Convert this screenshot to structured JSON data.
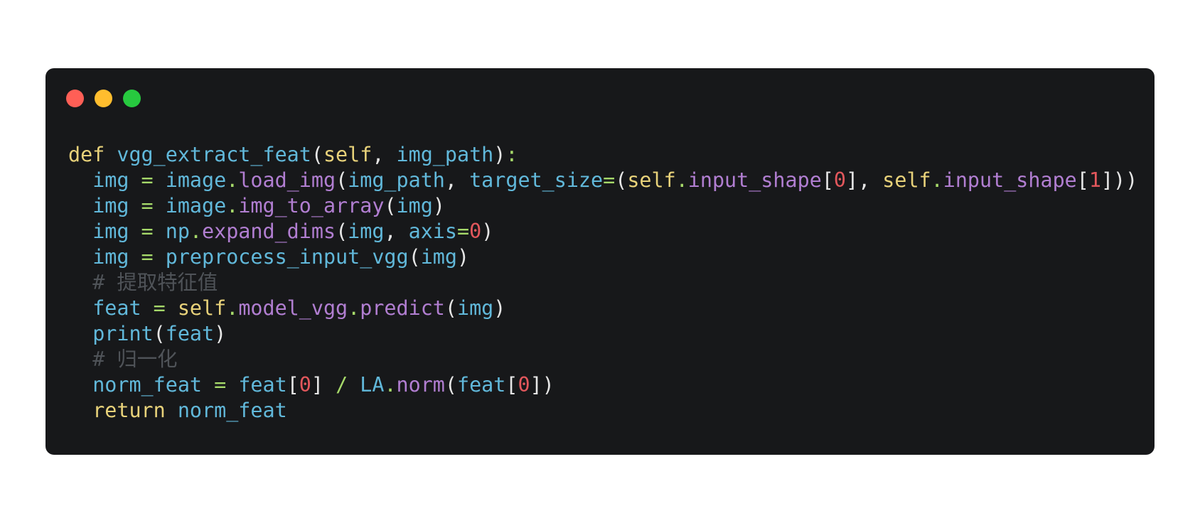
{
  "window": {
    "traffic_lights": [
      {
        "name": "close",
        "color": "#ff5f56"
      },
      {
        "name": "minimize",
        "color": "#ffbd2e"
      },
      {
        "name": "zoom",
        "color": "#27c93f"
      }
    ],
    "background_color": "#17181a"
  },
  "code": {
    "lines": [
      [
        {
          "t": "def",
          "k": "keyword"
        },
        {
          "t": " ",
          "k": "punct"
        },
        {
          "t": "vgg_extract_feat",
          "k": "fn"
        },
        {
          "t": "(",
          "k": "punct"
        },
        {
          "t": "self",
          "k": "self"
        },
        {
          "t": ", ",
          "k": "punct"
        },
        {
          "t": "img_path",
          "k": "var"
        },
        {
          "t": ")",
          "k": "punct"
        },
        {
          "t": ":",
          "k": "op"
        }
      ],
      [
        {
          "t": "  ",
          "k": "punct"
        },
        {
          "t": "img",
          "k": "var"
        },
        {
          "t": " = ",
          "k": "op"
        },
        {
          "t": "image",
          "k": "var"
        },
        {
          "t": ".",
          "k": "op"
        },
        {
          "t": "load_img",
          "k": "attr"
        },
        {
          "t": "(",
          "k": "punct"
        },
        {
          "t": "img_path",
          "k": "var"
        },
        {
          "t": ", ",
          "k": "punct"
        },
        {
          "t": "target_size",
          "k": "var"
        },
        {
          "t": "=",
          "k": "op"
        },
        {
          "t": "(",
          "k": "punct"
        },
        {
          "t": "self",
          "k": "self"
        },
        {
          "t": ".",
          "k": "op"
        },
        {
          "t": "input_shape",
          "k": "attr"
        },
        {
          "t": "[",
          "k": "punct"
        },
        {
          "t": "0",
          "k": "num"
        },
        {
          "t": "], ",
          "k": "punct"
        },
        {
          "t": "self",
          "k": "self"
        },
        {
          "t": ".",
          "k": "op"
        },
        {
          "t": "input_shape",
          "k": "attr"
        },
        {
          "t": "[",
          "k": "punct"
        },
        {
          "t": "1",
          "k": "num"
        },
        {
          "t": "]))",
          "k": "punct"
        }
      ],
      [
        {
          "t": "  ",
          "k": "punct"
        },
        {
          "t": "img",
          "k": "var"
        },
        {
          "t": " = ",
          "k": "op"
        },
        {
          "t": "image",
          "k": "var"
        },
        {
          "t": ".",
          "k": "op"
        },
        {
          "t": "img_to_array",
          "k": "attr"
        },
        {
          "t": "(",
          "k": "punct"
        },
        {
          "t": "img",
          "k": "var"
        },
        {
          "t": ")",
          "k": "punct"
        }
      ],
      [
        {
          "t": "  ",
          "k": "punct"
        },
        {
          "t": "img",
          "k": "var"
        },
        {
          "t": " = ",
          "k": "op"
        },
        {
          "t": "np",
          "k": "var"
        },
        {
          "t": ".",
          "k": "op"
        },
        {
          "t": "expand_dims",
          "k": "attr"
        },
        {
          "t": "(",
          "k": "punct"
        },
        {
          "t": "img",
          "k": "var"
        },
        {
          "t": ", ",
          "k": "punct"
        },
        {
          "t": "axis",
          "k": "var"
        },
        {
          "t": "=",
          "k": "op"
        },
        {
          "t": "0",
          "k": "num"
        },
        {
          "t": ")",
          "k": "punct"
        }
      ],
      [
        {
          "t": "  ",
          "k": "punct"
        },
        {
          "t": "img",
          "k": "var"
        },
        {
          "t": " = ",
          "k": "op"
        },
        {
          "t": "preprocess_input_vgg",
          "k": "fn"
        },
        {
          "t": "(",
          "k": "punct"
        },
        {
          "t": "img",
          "k": "var"
        },
        {
          "t": ")",
          "k": "punct"
        }
      ],
      [
        {
          "t": "  ",
          "k": "punct"
        },
        {
          "t": "# 提取特征值",
          "k": "comment"
        }
      ],
      [
        {
          "t": "  ",
          "k": "punct"
        },
        {
          "t": "feat",
          "k": "var"
        },
        {
          "t": " = ",
          "k": "op"
        },
        {
          "t": "self",
          "k": "self"
        },
        {
          "t": ".",
          "k": "op"
        },
        {
          "t": "model_vgg",
          "k": "attr"
        },
        {
          "t": ".",
          "k": "op"
        },
        {
          "t": "predict",
          "k": "attr"
        },
        {
          "t": "(",
          "k": "punct"
        },
        {
          "t": "img",
          "k": "var"
        },
        {
          "t": ")",
          "k": "punct"
        }
      ],
      [
        {
          "t": "  ",
          "k": "punct"
        },
        {
          "t": "print",
          "k": "builtin"
        },
        {
          "t": "(",
          "k": "punct"
        },
        {
          "t": "feat",
          "k": "var"
        },
        {
          "t": ")",
          "k": "punct"
        }
      ],
      [
        {
          "t": "  ",
          "k": "punct"
        },
        {
          "t": "# 归一化",
          "k": "comment"
        }
      ],
      [
        {
          "t": "  ",
          "k": "punct"
        },
        {
          "t": "norm_feat",
          "k": "var"
        },
        {
          "t": " = ",
          "k": "op"
        },
        {
          "t": "feat",
          "k": "var"
        },
        {
          "t": "[",
          "k": "punct"
        },
        {
          "t": "0",
          "k": "num"
        },
        {
          "t": "] ",
          "k": "punct"
        },
        {
          "t": "/",
          "k": "op"
        },
        {
          "t": " ",
          "k": "punct"
        },
        {
          "t": "LA",
          "k": "var"
        },
        {
          "t": ".",
          "k": "op"
        },
        {
          "t": "norm",
          "k": "attr"
        },
        {
          "t": "(",
          "k": "punct"
        },
        {
          "t": "feat",
          "k": "var"
        },
        {
          "t": "[",
          "k": "punct"
        },
        {
          "t": "0",
          "k": "num"
        },
        {
          "t": "])",
          "k": "punct"
        }
      ],
      [
        {
          "t": "  ",
          "k": "punct"
        },
        {
          "t": "return",
          "k": "keyword"
        },
        {
          "t": " ",
          "k": "punct"
        },
        {
          "t": "norm_feat",
          "k": "var"
        }
      ]
    ]
  }
}
